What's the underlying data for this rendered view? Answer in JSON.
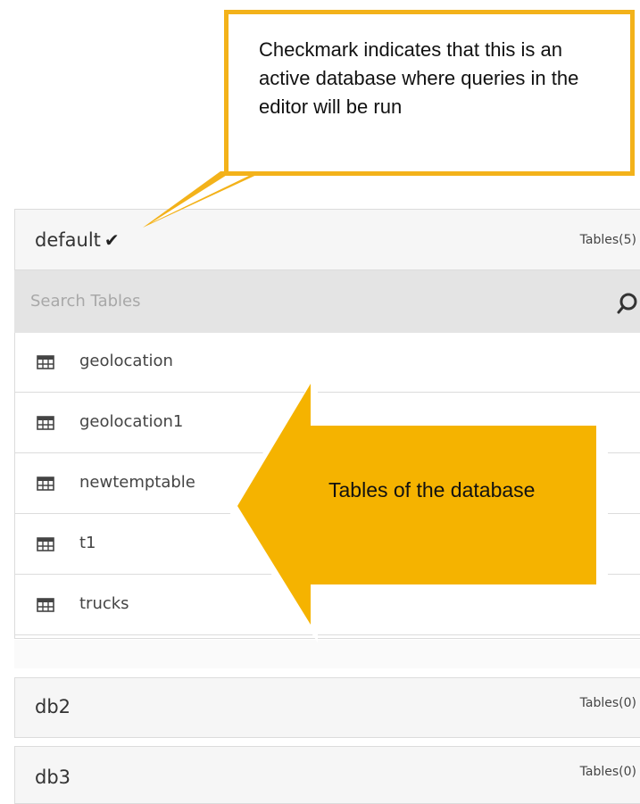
{
  "databases": [
    {
      "name": "default",
      "tables_label": "Tables(5)",
      "active": true
    },
    {
      "name": "db2",
      "tables_label": "Tables(0)",
      "active": false
    },
    {
      "name": "db3",
      "tables_label": "Tables(0)",
      "active": false
    }
  ],
  "search": {
    "placeholder": "Search Tables"
  },
  "tables": [
    "geolocation",
    "geolocation1",
    "newtemptable",
    "t1",
    "trucks"
  ],
  "annotations": {
    "callout_text": "Checkmark indicates that this is an active database where queries in the editor will be run",
    "arrow_text": "Tables of the database"
  },
  "colors": {
    "accent": "#f3b21a",
    "arrow_fill": "#f5b300",
    "header_bg": "#f6f6f6",
    "search_bg": "#e4e4e4"
  },
  "icons": {
    "active": "checkmark-icon",
    "table": "table-icon",
    "search": "search-icon"
  }
}
